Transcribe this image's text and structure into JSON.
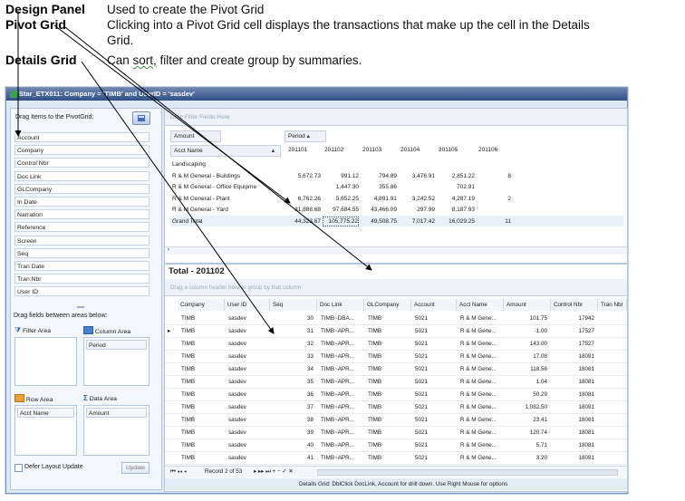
{
  "annotations": [
    {
      "title": "Design Panel",
      "desc": "Used to create the Pivot Grid"
    },
    {
      "title": "Pivot Grid",
      "desc1": "Clicking into a Pivot Grid cell displays the transactions that make up the cell in the Details",
      "desc2": "Grid."
    },
    {
      "title": "Details Grid",
      "desc_pre": "Can ",
      "desc_sq": "sort,",
      "desc_post": " filter and create group by summaries."
    }
  ],
  "window": {
    "title": "Star_ETX011: Company = 'TIMB' and UserID = 'sasdev'"
  },
  "design_panel": {
    "drag_label": "Drag Items to the PivotGrid:",
    "fields": [
      "Account",
      "Company",
      "Control Nbr",
      "Doc Link",
      "GLCompany",
      "In Date",
      "Narration",
      "Reference",
      "Screen",
      "Seq",
      "Tran Date",
      "Tran Nbr",
      "User ID"
    ],
    "between_label": "Drag fields between areas below:",
    "filter_area": "Filter Area",
    "column_area": "Column Area",
    "column_chip": "Period",
    "row_area": "Row Area",
    "data_area": "Data Area",
    "row_chip": "Acct Name",
    "data_chip": "Amount",
    "defer_label": "Defer Layout Update",
    "update_label": "Update"
  },
  "pivot": {
    "filter_hint": "Drop Filter Fields Here",
    "data_field": "Amount",
    "column_field": "Period",
    "row_field": "Acct Name",
    "periods": [
      "201101",
      "201102",
      "201103",
      "201104",
      "201105",
      "201106"
    ],
    "rows": [
      {
        "name": "Landscaping",
        "values": [
          "",
          "",
          "",
          "",
          "",
          ""
        ]
      },
      {
        "name": "R & M General - Buildings",
        "values": [
          "5,672.73",
          "991.12",
          "794.89",
          "3,476.91",
          "2,851.22",
          "8"
        ]
      },
      {
        "name": "R & M General - Office Equipme",
        "values": [
          "",
          "1,447.30",
          "355.86",
          "",
          "702.91",
          ""
        ]
      },
      {
        "name": "R & M General - Plant",
        "values": [
          "6,762.26",
          "5,652.25",
          "4,891.91",
          "3,242.52",
          "4,287.19",
          "2"
        ]
      },
      {
        "name": "R & M General - Yard",
        "values": [
          "31,888.68",
          "97,684.55",
          "43,466.09",
          "297.99",
          "8,187.93",
          ""
        ]
      },
      {
        "name": "Grand Total",
        "values": [
          "44,323.67",
          "105,775.22",
          "49,508.75",
          "7,017.42",
          "16,029.25",
          "11"
        ]
      }
    ]
  },
  "details": {
    "title": "Total - 201102",
    "group_hint": "Drag a column header here to group by that column",
    "columns": [
      "Company",
      "User ID",
      "Seq",
      "Doc Link",
      "GLCompany",
      "Account",
      "Acct Name",
      "Amount",
      "Control Nbr",
      "Tran Nbr"
    ],
    "rows": [
      [
        "TIMB",
        "sasdev",
        "30",
        "TIMB~DBA...",
        "TIMB",
        "5021",
        "R & M Gene...",
        "101.75",
        "17942"
      ],
      [
        "TIMB",
        "sasdev",
        "31",
        "TIMB~APR...",
        "TIMB",
        "5021",
        "R & M Gene...",
        "-1.00",
        "17527"
      ],
      [
        "TIMB",
        "sasdev",
        "32",
        "TIMB~APR...",
        "TIMB",
        "5021",
        "R & M Gene...",
        "143.00",
        "17527"
      ],
      [
        "TIMB",
        "sasdev",
        "33",
        "TIMB~APR...",
        "TIMB",
        "5021",
        "R & M Gene...",
        "17.08",
        "18081"
      ],
      [
        "TIMB",
        "sasdev",
        "34",
        "TIMB~APR...",
        "TIMB",
        "5021",
        "R & M Gene...",
        "118.56",
        "18081"
      ],
      [
        "TIMB",
        "sasdev",
        "35",
        "TIMB~APR...",
        "TIMB",
        "5021",
        "R & M Gene...",
        "1.04",
        "18081"
      ],
      [
        "TIMB",
        "sasdev",
        "36",
        "TIMB~APR...",
        "TIMB",
        "5021",
        "R & M Gene...",
        "50.29",
        "18081"
      ],
      [
        "TIMB",
        "sasdev",
        "37",
        "TIMB~APR...",
        "TIMB",
        "5021",
        "R & M Gene...",
        "1,082.50",
        "18081"
      ],
      [
        "TIMB",
        "sasdev",
        "38",
        "TIMB~APR...",
        "TIMB",
        "5021",
        "R & M Gene...",
        "23.41",
        "18081"
      ],
      [
        "TIMB",
        "sasdev",
        "39",
        "TIMB~APR...",
        "TIMB",
        "5021",
        "R & M Gene...",
        "120.74",
        "18081"
      ],
      [
        "TIMB",
        "sasdev",
        "40",
        "TIMB~APR...",
        "TIMB",
        "5021",
        "R & M Gene...",
        "5.71",
        "18081"
      ],
      [
        "TIMB",
        "sasdev",
        "41",
        "TIMB~APR...",
        "TIMB",
        "5021",
        "R & M Gene...",
        "3.20",
        "18081"
      ]
    ],
    "nav_text": "Record 2 of 53",
    "status": "Details Grid: DblClick DocLink, Account for drill down.  Use Right Mouse for options"
  }
}
